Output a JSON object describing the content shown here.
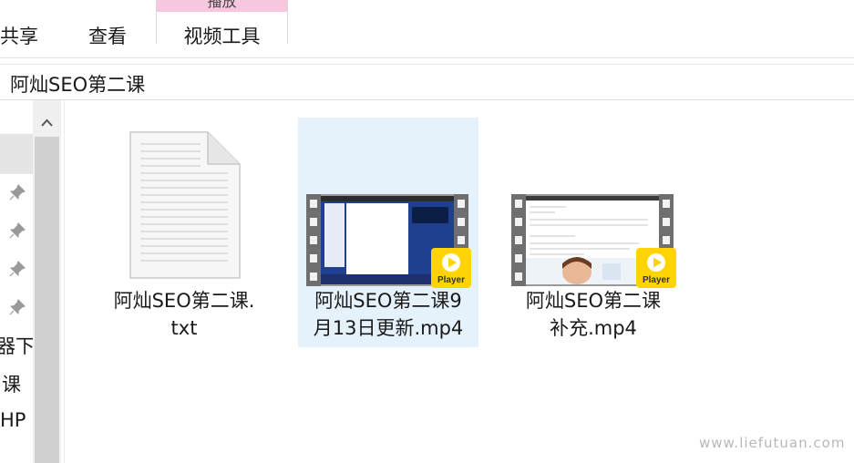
{
  "ribbon": {
    "tabs": [
      "共享",
      "查看"
    ],
    "context_tab_group": "播放",
    "context_tab": "视频工具"
  },
  "address": {
    "path": "阿灿SEO第二课"
  },
  "nav": {
    "items": [
      "器下",
      "课",
      "HP"
    ]
  },
  "files": [
    {
      "line1": "阿灿SEO第二课.",
      "line2": "txt",
      "type": "text-file-icon",
      "selected": false
    },
    {
      "line1": "阿灿SEO第二课9",
      "line2": "月13日更新.mp4",
      "type": "video-thumbnail",
      "selected": true
    },
    {
      "line1": "阿灿SEO第二课",
      "line2": "补充.mp4",
      "type": "video-thumbnail",
      "selected": false
    }
  ],
  "badge": "Player",
  "watermark": "www.liefutuan.com"
}
